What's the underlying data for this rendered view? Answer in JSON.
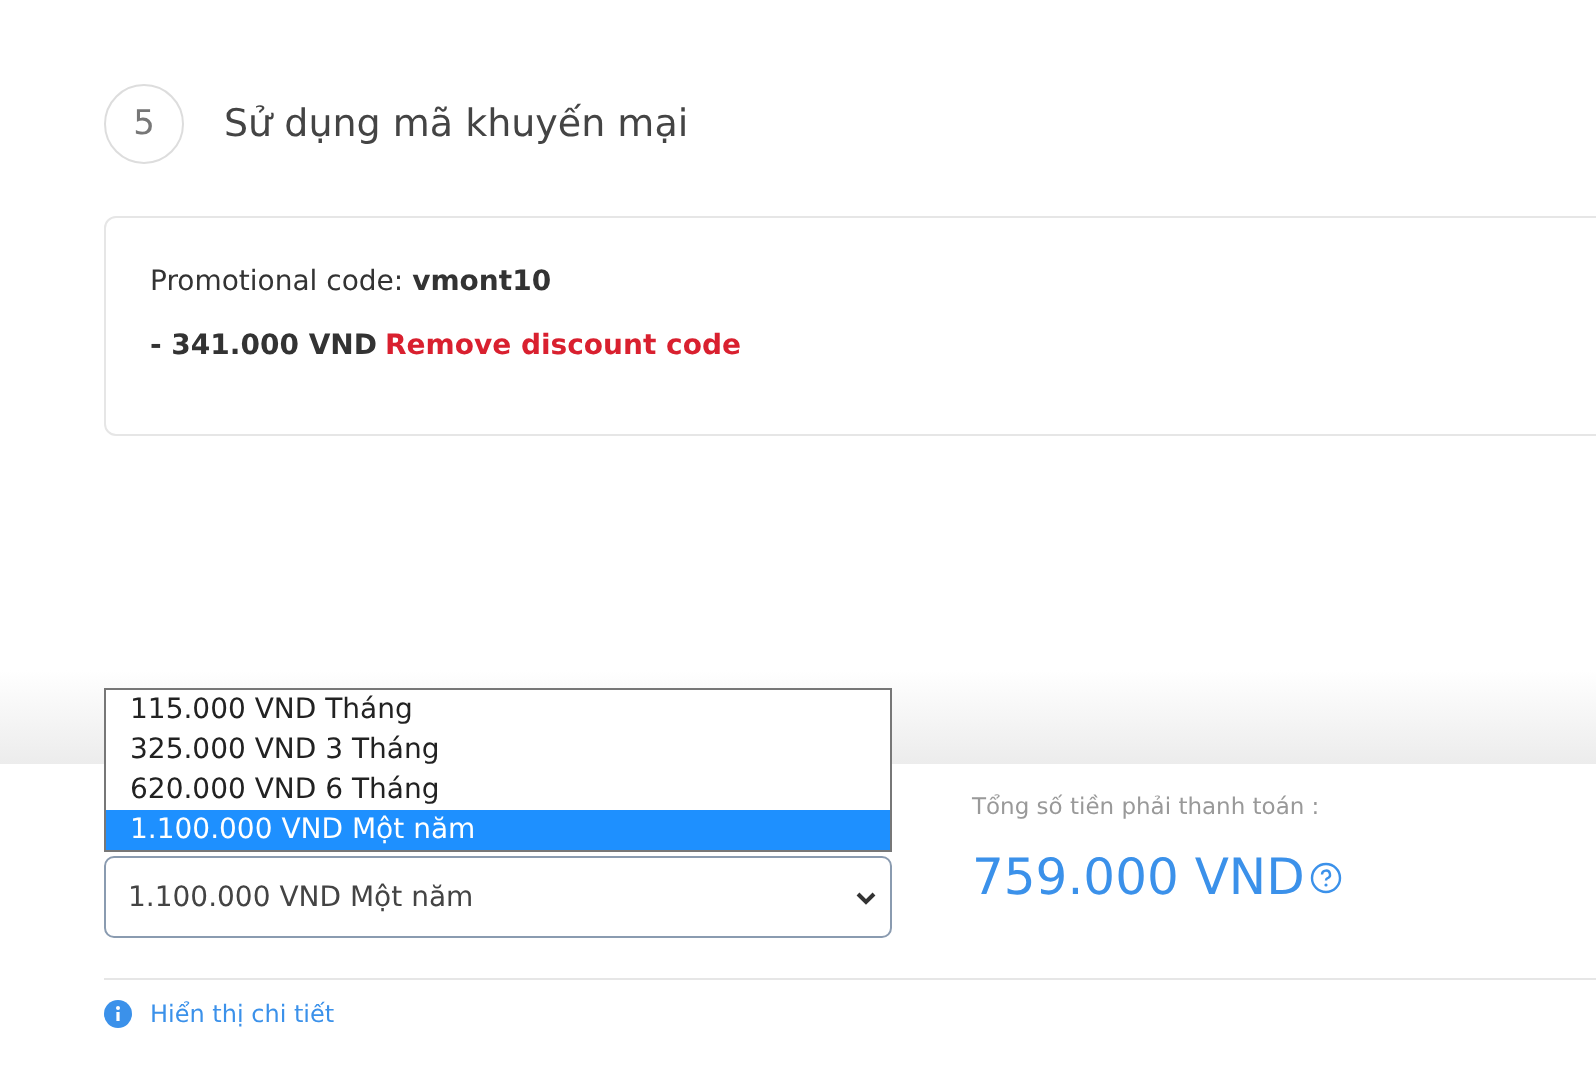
{
  "step": {
    "number": "5",
    "title": "Sử dụng mã khuyến mại"
  },
  "promo": {
    "label": "Promotional code:",
    "code": "vmont10",
    "discount": "- 341.000 VND",
    "remove_link": "Remove discount code"
  },
  "plan_select": {
    "value": "1.100.000 VND Một năm",
    "options": [
      {
        "label": "115.000 VND Tháng",
        "selected": false
      },
      {
        "label": "325.000 VND 3 Tháng",
        "selected": false
      },
      {
        "label": "620.000 VND 6 Tháng",
        "selected": false
      },
      {
        "label": "1.100.000 VND Một năm",
        "selected": true
      }
    ]
  },
  "total": {
    "label": "Tổng số tiền phải thanh toán :",
    "amount": "759.000 VND"
  },
  "details_link": "Hiển thị chi tiết"
}
